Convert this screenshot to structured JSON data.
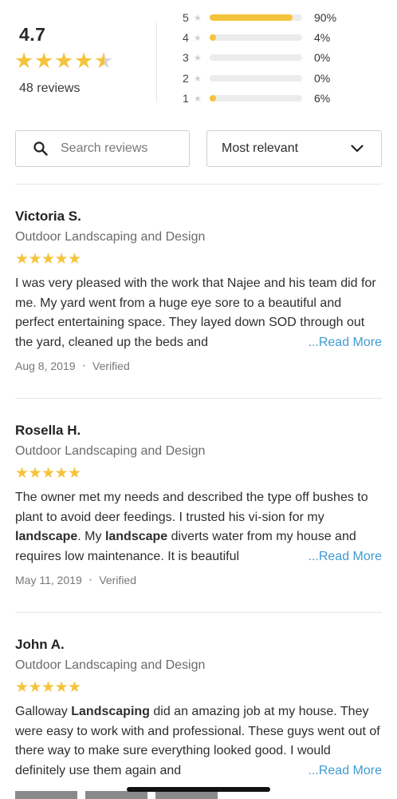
{
  "summary": {
    "average": "4.7",
    "reviews_count": "48 reviews",
    "rating_stars": 4.5,
    "breakdown": [
      {
        "stars": "5",
        "percent": "90%",
        "fraction": 0.9
      },
      {
        "stars": "4",
        "percent": "4%",
        "fraction": 0.04
      },
      {
        "stars": "3",
        "percent": "0%",
        "fraction": 0.0
      },
      {
        "stars": "2",
        "percent": "0%",
        "fraction": 0.0
      },
      {
        "stars": "1",
        "percent": "6%",
        "fraction": 0.06
      }
    ]
  },
  "controls": {
    "search_placeholder": "Search reviews",
    "sort_selected": "Most relevant"
  },
  "reviews": [
    {
      "name": "Victoria S.",
      "service": "Outdoor Landscaping and Design",
      "rating": 5,
      "text_html": "I was very pleased with the work that Najee and his team did for me. My yard went from a huge eye sore to a beautiful and perfect entertaining space. They layed down SOD through out the yard, cleaned up the beds and",
      "read_more": "...Read More",
      "date": "Aug 8, 2019",
      "status": "Verified"
    },
    {
      "name": "Rosella H.",
      "service": "Outdoor Landscaping and Design",
      "rating": 5,
      "text_html": "The owner met my needs and described the type off bushes to plant to avoid deer feedings. I trusted his vi-sion for my <b>landscape</b>. My <b>landscape</b> diverts water from my house and requires low maintenance. It is beautiful",
      "read_more": "...Read More",
      "date": "May 11, 2019",
      "status": "Verified"
    },
    {
      "name": "John A.",
      "service": "Outdoor Landscaping and Design",
      "rating": 5,
      "text_html": "Galloway <b>Landscaping</b> did an amazing job at my house. They were easy to work with and professional. These guys went out of there way to make sure everything looked good. I would definitely use them again and",
      "read_more": "...Read More",
      "date": "",
      "status": ""
    }
  ],
  "colors": {
    "star": "#f5c33b",
    "link": "#3f9bd2"
  },
  "icons": {
    "search": "search-icon",
    "sort": "chevron-down-icon",
    "star": "star-icon"
  }
}
